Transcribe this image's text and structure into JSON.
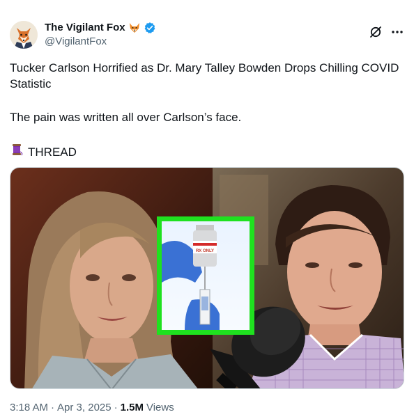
{
  "author": {
    "name": "The Vigilant Fox",
    "handle": "@VigilantFox",
    "name_emoji": "fox-face-icon",
    "verified_color": "#1d9bf0"
  },
  "post": {
    "line1": "Tucker Carlson Horrified as Dr. Mary Talley Bowden Drops Chilling COVID Statistic",
    "line2": "The pain was written all over Carlson’s face.",
    "thread_label": "THREAD",
    "thread_emoji": "spool-of-thread-icon"
  },
  "media": {
    "vial_label": "RX ONLY",
    "inset_border_color": "#1fe11f"
  },
  "footer": {
    "time": "3:18 AM",
    "sep1": "·",
    "date": "Apr 3, 2025",
    "sep2": "·",
    "views_count": "1.5M",
    "views_label": "Views"
  },
  "colors": {
    "text": "#0f1419",
    "secondary": "#536471",
    "border": "#cfd9de"
  }
}
